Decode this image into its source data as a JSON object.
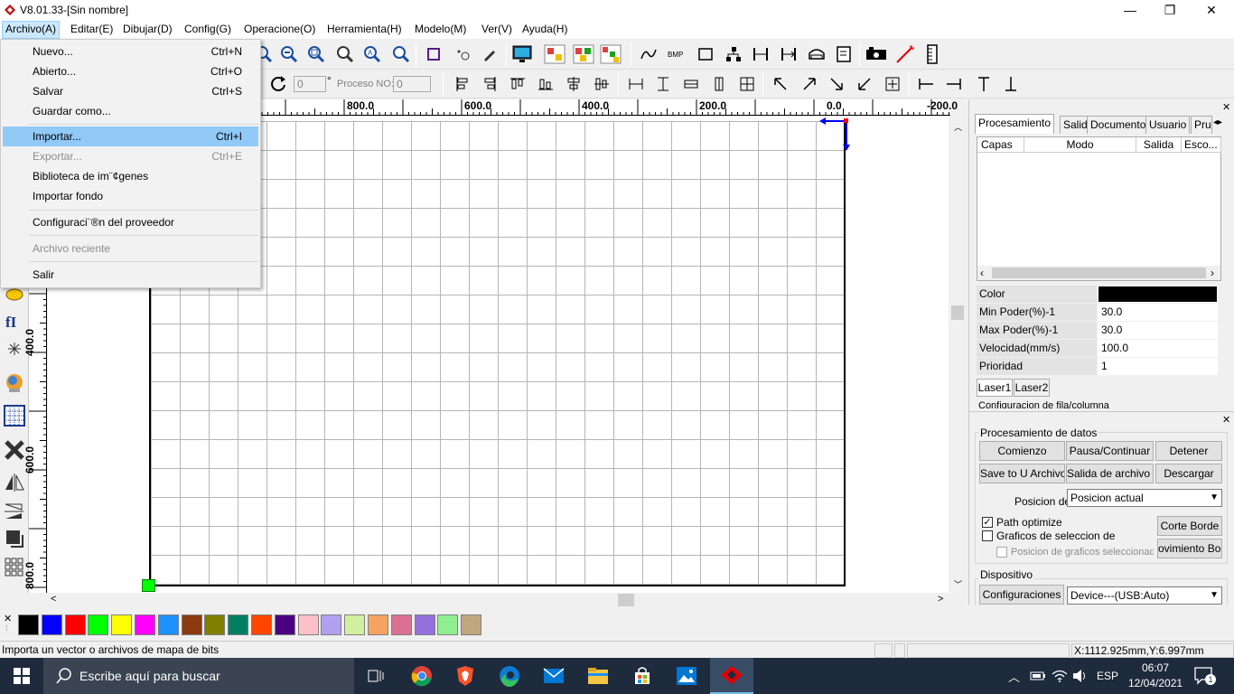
{
  "window": {
    "title": "V8.01.33-[Sin nombre]",
    "minimize": "—",
    "restore": "❐",
    "close": "✕"
  },
  "menu": [
    "Archivo(A)",
    "Editar(E)",
    "Dibujar(D)",
    "Config(G)",
    "Operacione(O)",
    "Herramienta(H)",
    "Modelo(M)",
    "Ver(V)",
    "Ayuda(H)"
  ],
  "file_menu": [
    {
      "label": "Nuevo...",
      "shortcut": "Ctrl+N"
    },
    {
      "label": "Abierto...",
      "shortcut": "Ctrl+O"
    },
    {
      "label": "Salvar",
      "shortcut": "Ctrl+S"
    },
    {
      "label": "Guardar como...",
      "shortcut": ""
    },
    {
      "label": "Importar...",
      "shortcut": "Ctrl+I"
    },
    {
      "label": "Exportar...",
      "shortcut": "Ctrl+E"
    },
    {
      "label": "Biblioteca de im¨¢genes",
      "shortcut": ""
    },
    {
      "label": "Importar fondo",
      "shortcut": ""
    },
    {
      "label": "Configuraci¨®n del proveedor",
      "shortcut": ""
    },
    {
      "label": "Archivo reciente",
      "shortcut": ""
    },
    {
      "label": "Salir",
      "shortcut": ""
    }
  ],
  "toolbar2": {
    "angle_value": "0",
    "degree": "°",
    "proceso_label": "Proceso NO:",
    "proceso_value": "0"
  },
  "rulers": {
    "h": [
      "800.0",
      "600.0",
      "400.0",
      "200.0",
      "0.0",
      "-200.0"
    ],
    "v": [
      "400.0",
      "600.0",
      "800.0"
    ]
  },
  "right_panel": {
    "tabs": [
      "Procesamiento",
      "Salida",
      "Documento",
      "Usuario",
      "Pru"
    ],
    "layers_headers": [
      "Capas",
      "Modo",
      "Salida",
      "Esco..."
    ],
    "props": [
      {
        "label": "Color",
        "value": ""
      },
      {
        "label": "Min Poder(%)-1",
        "value": "30.0"
      },
      {
        "label": "Max Poder(%)-1",
        "value": "30.0"
      },
      {
        "label": "Velocidad(mm/s)",
        "value": "100.0"
      },
      {
        "label": "Prioridad",
        "value": "1"
      }
    ],
    "color_value": "#000000",
    "laser_tabs": [
      "Laser1",
      "Laser2"
    ],
    "row_config_partial": "Configuracion de fila/columna",
    "data_group": "Procesamiento de datos",
    "buttons_row1": [
      "Comienzo",
      "Pausa/Continuar",
      "Detener"
    ],
    "buttons_row2": [
      "Save to U Archivo",
      "Salida de archivo U",
      "Descargar"
    ],
    "posicion_label": "Posicion de",
    "posicion_value": "Posicion actual",
    "path_optimize": "Path optimize",
    "graficos_sel": "Graficos de seleccion de",
    "posicion_graficos": "Posicion de graficos seleccionado",
    "corte_borde": "Corte Borde",
    "movimiento_borde": "ovimiento Bord",
    "device_group": "Dispositivo",
    "config_button": "Configuraciones",
    "device_value": "Device---(USB:Auto)"
  },
  "palette": [
    "#000000",
    "#0000ff",
    "#ff0000",
    "#00ff00",
    "#ffff00",
    "#ff00ff",
    "#1e90ff",
    "#8b3a0f",
    "#808000",
    "#008060",
    "#ff4500",
    "#4b0082",
    "#ffc0cb",
    "#b0a0f0",
    "#d0f0a0",
    "#f4a460",
    "#db7093",
    "#9370db",
    "#90ee90",
    "#bfa77f"
  ],
  "status": {
    "message": "Importa un vector o archivos de mapa de bits",
    "coords": "X:1112.925mm,Y:6.997mm"
  },
  "taskbar": {
    "search_placeholder": "Escribe aquí para buscar",
    "lang": "ESP",
    "time": "06:07",
    "date": "12/04/2021",
    "notif_count": "1"
  }
}
